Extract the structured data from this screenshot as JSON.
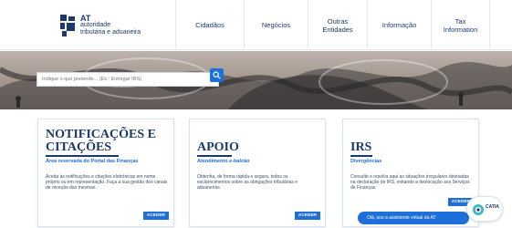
{
  "header": {
    "logo": {
      "line1": "AT",
      "line2": "autoridade",
      "line3": "tributária e aduaneira"
    },
    "nav": [
      {
        "label": "Cidadãos"
      },
      {
        "label": "Negócios"
      },
      {
        "label": "Outras Entidades"
      },
      {
        "label": "Informação"
      },
      {
        "label": "Tax Information"
      }
    ]
  },
  "hero": {
    "search_placeholder": "Indique o que pretende... (Ex.: Entregar IRS)"
  },
  "cards": [
    {
      "title_line1": "NOTIFICAÇÕES E",
      "title_line2": "CITAÇÕES",
      "subtitle": "Área reservada do Portal das Finanças",
      "description": "Aceda às notificações e citações eletrónicas em nome próprio ou em representação. Faça a sua gestão dos canais de receção das mesmas.",
      "button": "ACEDER"
    },
    {
      "title_line1": "APOIO",
      "subtitle": "Atendimento e-balcão",
      "description": "Obtenha, de forma rápida e segura, todos os esclarecimentos sobre as obrigações tributárias e aduaneiras.",
      "button": "ACEDER"
    },
    {
      "title_line1": "IRS",
      "subtitle": "Divergências",
      "description": "Consulte e resolva aqui as situações irregulares detetadas na declaração de IRS, evitando a deslocação aos Serviços de Finanças.",
      "button": "ACEDER"
    }
  ],
  "chat": {
    "bubble": "Olá, sou a assistente virtual da AT",
    "avatar_label": "CATIA"
  },
  "colors": {
    "brand": "#1b3a6b",
    "accent": "#1e6fd9"
  }
}
